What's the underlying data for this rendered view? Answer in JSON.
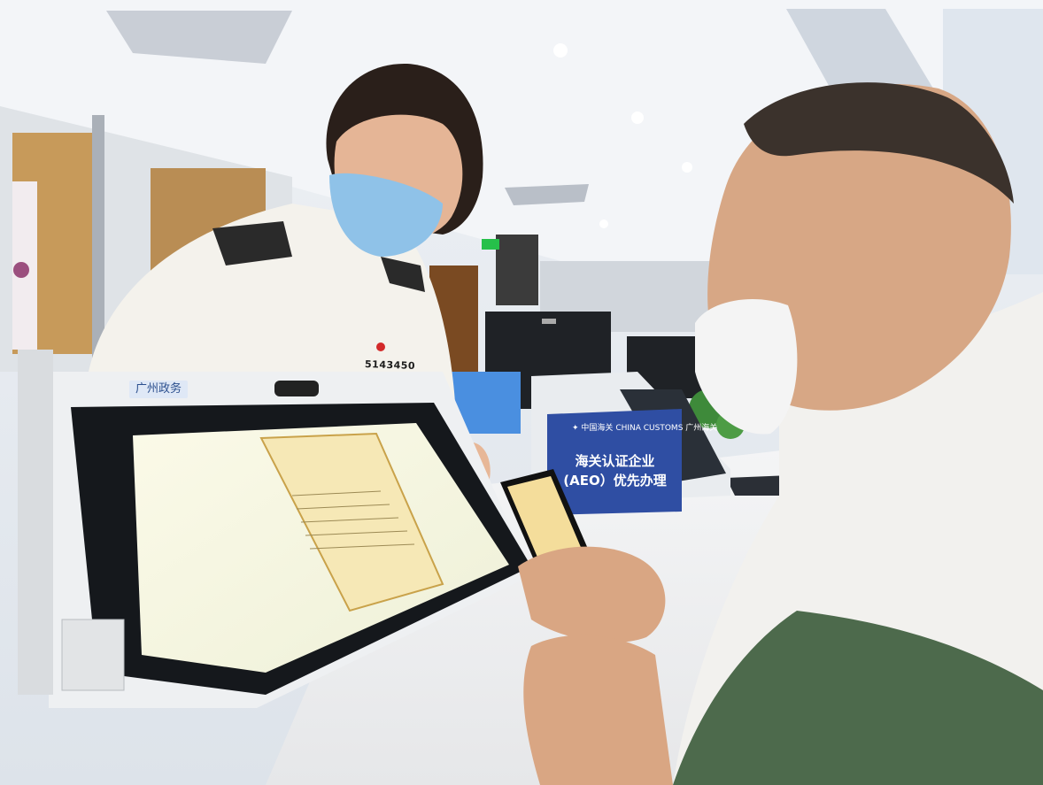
{
  "scene": {
    "kiosk_label": "广州政务",
    "badge_number": "5143450",
    "sign": {
      "logo_cn": "中国海关",
      "logo_en": "CHINA CUSTOMS",
      "office": "广州海关",
      "line1": "海关认证企业",
      "line2": "(AEO）优先办理"
    },
    "colors": {
      "sign_blue": "#2f4ea3",
      "uniform": "#f4f2ec",
      "shirt_green": "#4d6a4c",
      "kiosk_body": "#eef0f2",
      "screen_cream": "#f7f5df",
      "mask_blue": "#8fc2e8"
    }
  }
}
